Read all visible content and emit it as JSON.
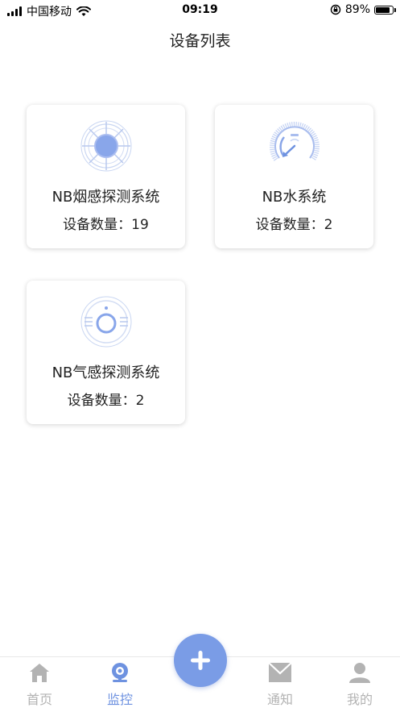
{
  "status_bar": {
    "carrier": "中国移动",
    "time": "09:19",
    "battery": "89%",
    "battery_level": 0.89
  },
  "page_title": "设备列表",
  "devices": [
    {
      "name": "NB烟感探测系统",
      "count": "设备数量：19",
      "icon": "smoke-detector-icon"
    },
    {
      "name": "NB水系统",
      "count": "设备数量：2",
      "icon": "water-gauge-icon"
    },
    {
      "name": "NB气感探测系统",
      "count": "设备数量：2",
      "icon": "gas-detector-icon"
    }
  ],
  "tabs": [
    {
      "label": "首页",
      "icon": "home-icon",
      "active": false
    },
    {
      "label": "监控",
      "icon": "camera-icon",
      "active": true
    },
    {
      "label": "通知",
      "icon": "mail-icon",
      "active": false
    },
    {
      "label": "我的",
      "icon": "user-icon",
      "active": false
    }
  ],
  "add_button": {
    "icon": "plus-icon"
  },
  "colors": {
    "accent": "#7a9ce6",
    "active_tab": "#6e92e0",
    "inactive_tab": "#b3b3b3"
  }
}
